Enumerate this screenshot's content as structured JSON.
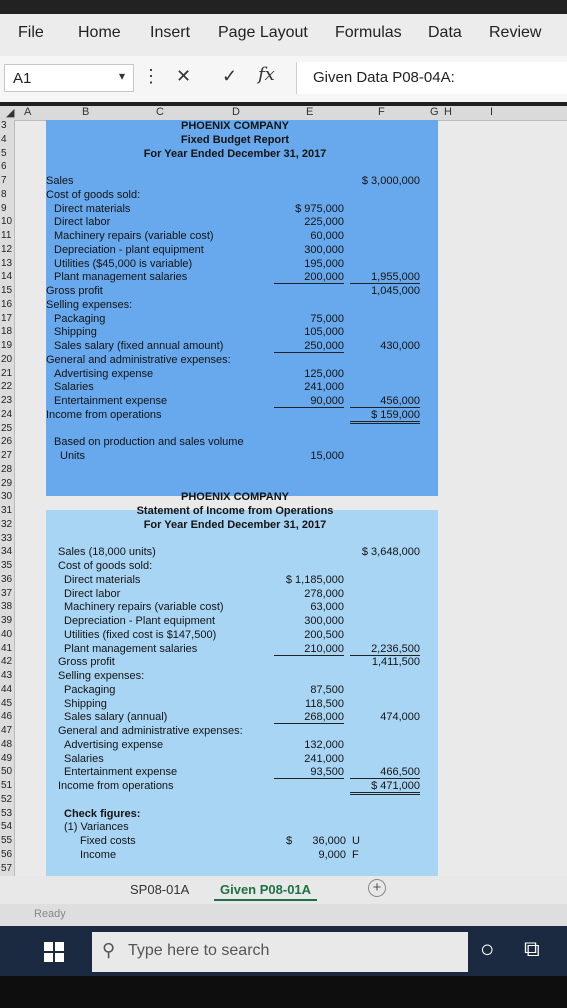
{
  "ribbon_tabs": [
    "File",
    "Home",
    "Insert",
    "Page Layout",
    "Formulas",
    "Data",
    "Review"
  ],
  "formula_bar": {
    "name_box": "A1",
    "formula": "Given Data P08-04A:",
    "cancel": "✕",
    "confirm": "✓",
    "fx": "fx",
    "more": "⋮",
    "dropdown": "▾"
  },
  "columns": [
    "A",
    "B",
    "C",
    "D",
    "E",
    "F",
    "G",
    "H",
    "I"
  ],
  "rows": [
    "3",
    "4",
    "5",
    "6",
    "7",
    "8",
    "9",
    "10",
    "11",
    "12",
    "13",
    "14",
    "15",
    "16",
    "17",
    "18",
    "19",
    "20",
    "21",
    "22",
    "23",
    "24",
    "25",
    "26",
    "27",
    "28",
    "29",
    "30",
    "31",
    "32",
    "33",
    "34",
    "35",
    "36",
    "37",
    "38",
    "39",
    "40",
    "41",
    "42",
    "43",
    "44",
    "45",
    "46",
    "47",
    "48",
    "49",
    "50",
    "51",
    "52",
    "53",
    "54",
    "55",
    "56",
    "57"
  ],
  "report1": {
    "company": "PHOENIX COMPANY",
    "title": "Fixed Budget Report",
    "period": "For Year Ended December 31, 2017",
    "lines": [
      {
        "label": "Sales",
        "indent": 0,
        "e": "",
        "f": "$ 3,000,000"
      },
      {
        "label": "Cost of goods sold:",
        "indent": 0,
        "e": "",
        "f": ""
      },
      {
        "label": "Direct materials",
        "indent": 1,
        "e": "$   975,000",
        "f": ""
      },
      {
        "label": "Direct labor",
        "indent": 1,
        "e": "225,000",
        "f": ""
      },
      {
        "label": "Machinery repairs (variable cost)",
        "indent": 1,
        "e": "60,000",
        "f": ""
      },
      {
        "label": "Depreciation - plant equipment",
        "indent": 1,
        "e": "300,000",
        "f": ""
      },
      {
        "label": "Utilities ($45,000 is variable)",
        "indent": 1,
        "e": "195,000",
        "f": ""
      },
      {
        "label": "Plant management salaries",
        "indent": 1,
        "e": "200,000",
        "f": "1,955,000"
      },
      {
        "label": "Gross profit",
        "indent": 0,
        "e": "",
        "f": "1,045,000"
      },
      {
        "label": "Selling expenses:",
        "indent": 0,
        "e": "",
        "f": ""
      },
      {
        "label": "Packaging",
        "indent": 1,
        "e": "75,000",
        "f": ""
      },
      {
        "label": "Shipping",
        "indent": 1,
        "e": "105,000",
        "f": ""
      },
      {
        "label": "Sales salary (fixed annual amount)",
        "indent": 1,
        "e": "250,000",
        "f": "430,000"
      },
      {
        "label": "General and administrative expenses:",
        "indent": 0,
        "e": "",
        "f": ""
      },
      {
        "label": "Advertising expense",
        "indent": 1,
        "e": "125,000",
        "f": ""
      },
      {
        "label": "Salaries",
        "indent": 1,
        "e": "241,000",
        "f": ""
      },
      {
        "label": "Entertainment expense",
        "indent": 1,
        "e": "90,000",
        "f": "456,000"
      },
      {
        "label": "Income from operations",
        "indent": 0,
        "e": "",
        "f": "$   159,000"
      }
    ],
    "basis_label": "Based on production and sales volume",
    "units_label": "Units",
    "units_value": "15,000"
  },
  "report2": {
    "company": "PHOENIX COMPANY",
    "title": "Statement of Income from Operations",
    "period": "For Year Ended December 31, 2017",
    "lines": [
      {
        "label": "Sales (18,000 units)",
        "indent": 0,
        "e": "",
        "f": "$ 3,648,000"
      },
      {
        "label": "Cost of goods sold:",
        "indent": 0,
        "e": "",
        "f": ""
      },
      {
        "label": "Direct materials",
        "indent": 1,
        "e": "$ 1,185,000",
        "f": ""
      },
      {
        "label": "Direct labor",
        "indent": 1,
        "e": "278,000",
        "f": ""
      },
      {
        "label": "Machinery repairs (variable cost)",
        "indent": 1,
        "e": "63,000",
        "f": ""
      },
      {
        "label": "Depreciation - Plant equipment",
        "indent": 1,
        "e": "300,000",
        "f": ""
      },
      {
        "label": "Utilities (fixed cost is $147,500)",
        "indent": 1,
        "e": "200,500",
        "f": ""
      },
      {
        "label": "Plant management salaries",
        "indent": 1,
        "e": "210,000",
        "f": "2,236,500"
      },
      {
        "label": "Gross profit",
        "indent": 0,
        "e": "",
        "f": "1,411,500"
      },
      {
        "label": "Selling expenses:",
        "indent": 0,
        "e": "",
        "f": ""
      },
      {
        "label": "Packaging",
        "indent": 1,
        "e": "87,500",
        "f": ""
      },
      {
        "label": "Shipping",
        "indent": 1,
        "e": "118,500",
        "f": ""
      },
      {
        "label": "Sales salary (annual)",
        "indent": 1,
        "e": "268,000",
        "f": "474,000"
      },
      {
        "label": "General and administrative expenses:",
        "indent": 0,
        "e": "",
        "f": ""
      },
      {
        "label": "Advertising expense",
        "indent": 1,
        "e": "132,000",
        "f": ""
      },
      {
        "label": "Salaries",
        "indent": 1,
        "e": "241,000",
        "f": ""
      },
      {
        "label": "Entertainment expense",
        "indent": 1,
        "e": "93,500",
        "f": "466,500"
      },
      {
        "label": "Income from operations",
        "indent": 0,
        "e": "",
        "f": "$   471,000"
      }
    ],
    "check_title": "Check figures:",
    "check_sub": "(1) Variances",
    "checks": [
      {
        "label": "Fixed costs",
        "dollar": "$",
        "value": "36,000",
        "flag": "U"
      },
      {
        "label": "Income",
        "dollar": "",
        "value": "9,000",
        "flag": "F"
      }
    ]
  },
  "sheet_tabs": [
    "SP08-01A",
    "Given P08-01A"
  ],
  "add_sheet": "+",
  "status_text": "Ready",
  "taskbar": {
    "search_placeholder": "Type here to search",
    "search_icon": "⚲",
    "cortana_icon": "○",
    "taskview_icon": "⧉"
  }
}
